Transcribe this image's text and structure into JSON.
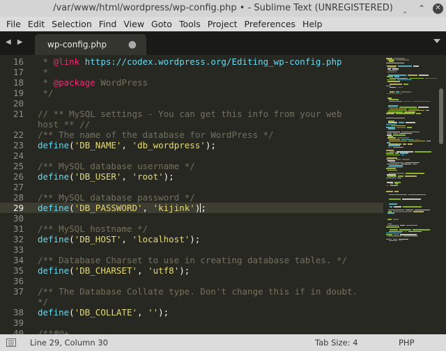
{
  "window": {
    "title": "/var/www/html/wordpress/wp-config.php • - Sublime Text (UNREGISTERED)",
    "minimize_glyph": "‸",
    "maximize_glyph": "⌃",
    "close_glyph": "✕"
  },
  "menu": [
    "File",
    "Edit",
    "Selection",
    "Find",
    "View",
    "Goto",
    "Tools",
    "Project",
    "Preferences",
    "Help"
  ],
  "tabs": [
    {
      "label": "wp-config.php",
      "modified_glyph": "●"
    }
  ],
  "nav_arrows": "◀ ▶",
  "editor": {
    "active_line": "29",
    "lines": [
      {
        "n": "16",
        "tokens": [
          {
            "t": " * ",
            "c": "c"
          },
          {
            "t": "@link",
            "c": "t"
          },
          {
            "t": " https://codex.wordpress.org/Editing_wp-config.php",
            "c": "k"
          }
        ]
      },
      {
        "n": "17",
        "tokens": [
          {
            "t": " *",
            "c": "c"
          }
        ]
      },
      {
        "n": "18",
        "tokens": [
          {
            "t": " * ",
            "c": "c"
          },
          {
            "t": "@package",
            "c": "t"
          },
          {
            "t": " WordPress",
            "c": "c"
          }
        ]
      },
      {
        "n": "19",
        "tokens": [
          {
            "t": " */",
            "c": "c"
          }
        ]
      },
      {
        "n": "20",
        "tokens": []
      },
      {
        "n": "21",
        "tokens": [
          {
            "t": "// ** MySQL settings - You can get this info from your web",
            "c": "c"
          }
        ]
      },
      {
        "n": "",
        "tokens": [
          {
            "t": "host ** //",
            "c": "c"
          }
        ]
      },
      {
        "n": "22",
        "tokens": [
          {
            "t": "/** The name of the database for WordPress */",
            "c": "c"
          }
        ]
      },
      {
        "n": "23",
        "tokens": [
          {
            "t": "define",
            "c": "k"
          },
          {
            "t": "(",
            "c": "p"
          },
          {
            "t": "'DB_NAME'",
            "c": "s"
          },
          {
            "t": ", ",
            "c": "p"
          },
          {
            "t": "'db_wordpress'",
            "c": "s"
          },
          {
            "t": ");",
            "c": "p"
          }
        ]
      },
      {
        "n": "24",
        "tokens": []
      },
      {
        "n": "25",
        "tokens": [
          {
            "t": "/** MySQL database username */",
            "c": "c"
          }
        ]
      },
      {
        "n": "26",
        "tokens": [
          {
            "t": "define",
            "c": "k"
          },
          {
            "t": "(",
            "c": "p"
          },
          {
            "t": "'DB_USER'",
            "c": "s"
          },
          {
            "t": ", ",
            "c": "p"
          },
          {
            "t": "'root'",
            "c": "s"
          },
          {
            "t": ");",
            "c": "p"
          }
        ]
      },
      {
        "n": "27",
        "tokens": []
      },
      {
        "n": "28",
        "tokens": [
          {
            "t": "/** MySQL database password */",
            "c": "c"
          }
        ]
      },
      {
        "n": "29",
        "tokens": [
          {
            "t": "define",
            "c": "k"
          },
          {
            "t": "(",
            "c": "p"
          },
          {
            "t": "'DB_PASSWORD'",
            "c": "s"
          },
          {
            "t": ", ",
            "c": "p"
          },
          {
            "t": "'kijink'",
            "c": "s"
          },
          {
            "t": ")",
            "c": "p"
          },
          {
            "t": "|",
            "c": "caret"
          },
          {
            "t": ";",
            "c": "p"
          }
        ]
      },
      {
        "n": "30",
        "tokens": []
      },
      {
        "n": "31",
        "tokens": [
          {
            "t": "/** MySQL hostname */",
            "c": "c"
          }
        ]
      },
      {
        "n": "32",
        "tokens": [
          {
            "t": "define",
            "c": "k"
          },
          {
            "t": "(",
            "c": "p"
          },
          {
            "t": "'DB_HOST'",
            "c": "s"
          },
          {
            "t": ", ",
            "c": "p"
          },
          {
            "t": "'localhost'",
            "c": "s"
          },
          {
            "t": ");",
            "c": "p"
          }
        ]
      },
      {
        "n": "33",
        "tokens": []
      },
      {
        "n": "34",
        "tokens": [
          {
            "t": "/** Database Charset to use in creating database tables. */",
            "c": "c"
          }
        ]
      },
      {
        "n": "35",
        "tokens": [
          {
            "t": "define",
            "c": "k"
          },
          {
            "t": "(",
            "c": "p"
          },
          {
            "t": "'DB_CHARSET'",
            "c": "s"
          },
          {
            "t": ", ",
            "c": "p"
          },
          {
            "t": "'utf8'",
            "c": "s"
          },
          {
            "t": ");",
            "c": "p"
          }
        ]
      },
      {
        "n": "36",
        "tokens": []
      },
      {
        "n": "37",
        "tokens": [
          {
            "t": "/** The Database Collate type. Don't change this if in doubt.",
            "c": "c"
          }
        ]
      },
      {
        "n": "",
        "tokens": [
          {
            "t": "*/",
            "c": "c"
          }
        ]
      },
      {
        "n": "38",
        "tokens": [
          {
            "t": "define",
            "c": "k"
          },
          {
            "t": "(",
            "c": "p"
          },
          {
            "t": "'DB_COLLATE'",
            "c": "s"
          },
          {
            "t": ", ",
            "c": "p"
          },
          {
            "t": "''",
            "c": "s"
          },
          {
            "t": ");",
            "c": "p"
          }
        ]
      },
      {
        "n": "39",
        "tokens": []
      },
      {
        "n": "40",
        "tokens": [
          {
            "t": "/**#@+",
            "c": "c"
          }
        ]
      }
    ]
  },
  "status": {
    "position": "Line 29, Column 30",
    "tab_size": "Tab Size: 4",
    "syntax": "PHP"
  },
  "colors": {
    "background": "#272822",
    "comment": "#75715e",
    "keyword": "#66d9ef",
    "string": "#e6db74",
    "tag": "#f92672"
  }
}
